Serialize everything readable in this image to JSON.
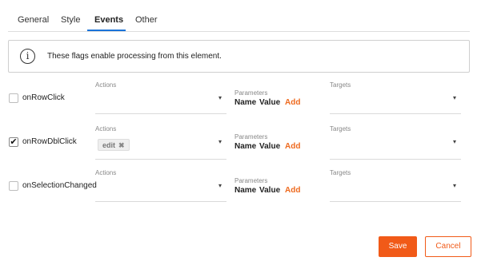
{
  "tabs": [
    {
      "label": "General"
    },
    {
      "label": "Style"
    },
    {
      "label": "Events"
    },
    {
      "label": "Other"
    }
  ],
  "active_tab": "Events",
  "info": {
    "icon": "info-icon",
    "text": "These flags enable processing from this element."
  },
  "column_labels": {
    "actions": "Actions",
    "parameters": "Parameters",
    "targets": "Targets"
  },
  "param_fields": {
    "name": "Name",
    "value": "Value",
    "add": "Add"
  },
  "events": [
    {
      "label": "onRowClick",
      "checked": false,
      "actions": []
    },
    {
      "label": "onRowDblClick",
      "checked": true,
      "actions": [
        "edit"
      ]
    },
    {
      "label": "onSelectionChanged",
      "checked": false,
      "actions": []
    }
  ],
  "chip_remove_glyph": "✖",
  "check_glyph": "✔",
  "dropdown_caret": "▾",
  "buttons": {
    "save": "Save",
    "cancel": "Cancel"
  },
  "colors": {
    "accent": "#f15a18",
    "tab_underline": "#1a73d9",
    "add_link": "#ee6a1f"
  }
}
